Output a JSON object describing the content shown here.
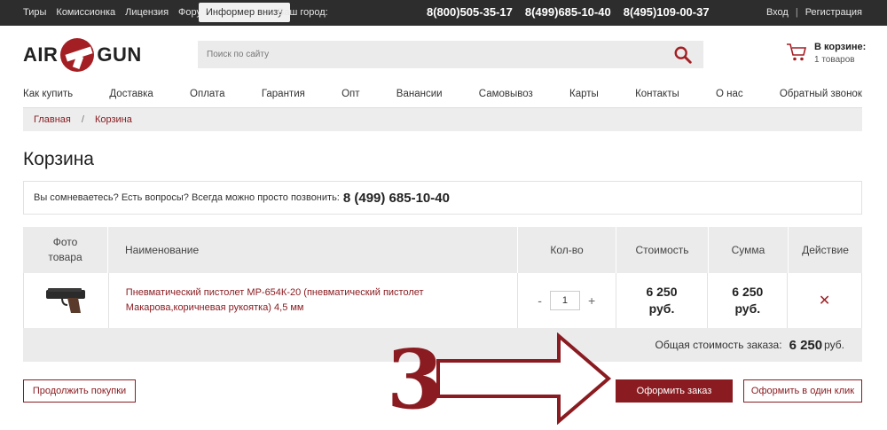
{
  "topbar": {
    "links": [
      "Тиры",
      "Комиссионка",
      "Лицензия",
      "Форум"
    ],
    "informer": "Информер внизу",
    "city_label": "Ваш город:",
    "phones": [
      "8(800)505-35-17",
      "8(499)685-10-40",
      "8(495)109-00-37"
    ],
    "login": "Вход",
    "separator": "|",
    "register": "Регистрация"
  },
  "header": {
    "logo_left": "AIR",
    "logo_right": "GUN",
    "search_placeholder": "Поиск по сайту",
    "cart_title": "В корзине:",
    "cart_count": "1 товаров"
  },
  "nav": [
    "Как купить",
    "Доставка",
    "Оплата",
    "Гарантия",
    "Опт",
    "Ванансии",
    "Самовывоз",
    "Карты",
    "Контакты",
    "О нас",
    "Обратный звонок"
  ],
  "breadcrumb": {
    "home": "Главная",
    "sep": "/",
    "current": "Корзина"
  },
  "page_title": "Корзина",
  "question": {
    "text": "Вы сомневаетесь? Есть вопросы? Всегда можно просто позвонить:",
    "phone": "8 (499) 685-10-40"
  },
  "table": {
    "headers": [
      "Фото товара",
      "Наименование",
      "Кол-во",
      "Стоимость",
      "Сумма",
      "Действие"
    ],
    "rows": [
      {
        "name": "Пневматический пистолет МР-654К-20 (пневматический пистолет Макарова,коричневая рукоятка) 4,5 мм",
        "minus": "-",
        "qty": "1",
        "plus": "+",
        "price_value": "6 250",
        "price_unit": "руб.",
        "sum_value": "6 250",
        "sum_unit": "руб.",
        "delete": "✕"
      }
    ],
    "total_label": "Общая стоимость заказа:",
    "total_value": "6 250",
    "total_unit": "руб."
  },
  "buttons": {
    "continue": "Продолжить покупки",
    "checkout": "Оформить заказ",
    "one_click": "Оформить в один клик"
  },
  "annotation": {
    "number": "3"
  },
  "colors": {
    "accent": "#8a1c21",
    "topbar": "#2d2d2d",
    "panel": "#ebebeb"
  }
}
